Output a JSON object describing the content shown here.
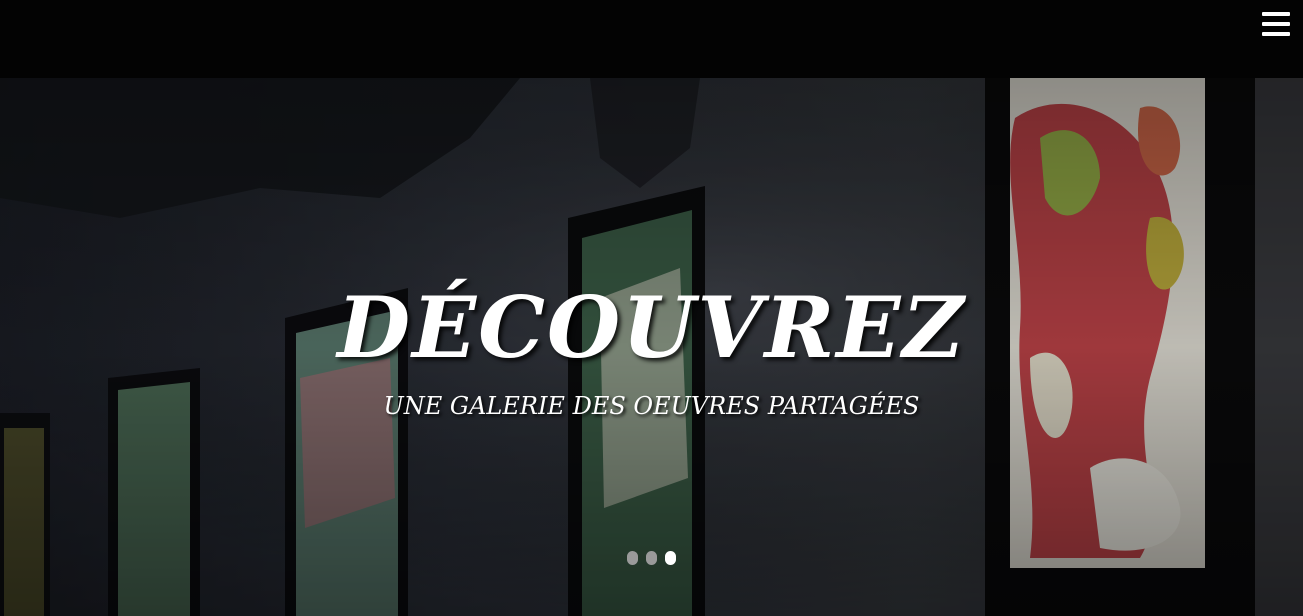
{
  "hero": {
    "title": "DÉCOUVREZ",
    "subtitle": "UNE GALERIE DES OEUVRES PARTAGÉES"
  },
  "menu": {
    "icon": "hamburger-menu-icon"
  },
  "carousel": {
    "slide_count": 3,
    "active_index": 2
  },
  "colors": {
    "topbar": "#030303",
    "text": "#ffffff",
    "dot_inactive": "#9a9a9a",
    "dot_active": "#ffffff"
  }
}
